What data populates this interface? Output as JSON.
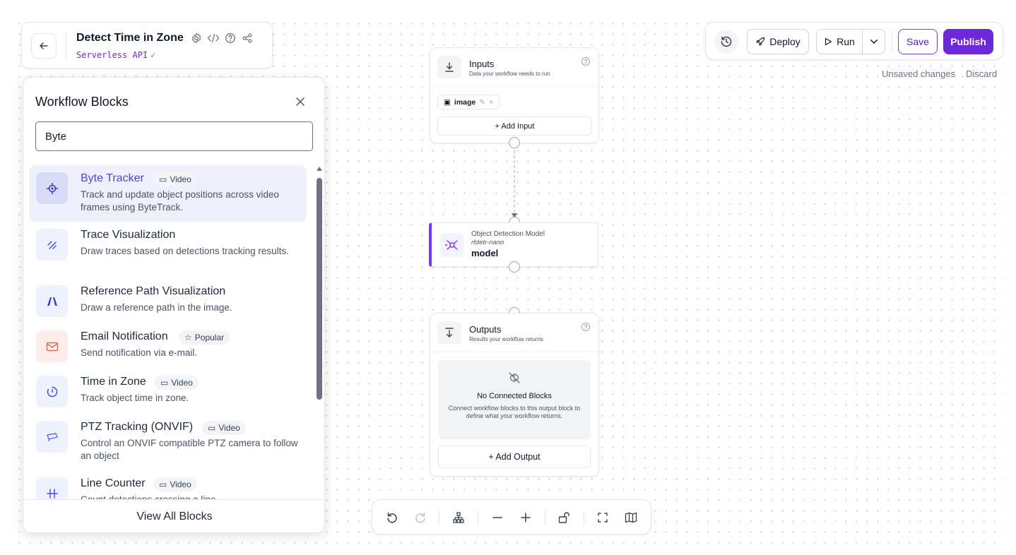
{
  "header": {
    "title": "Detect Time in Zone",
    "subtitle": "Serverless API",
    "icons": [
      "gear-icon",
      "code-icon",
      "help-icon",
      "share-icon"
    ]
  },
  "blocks_panel": {
    "title": "Workflow Blocks",
    "search_value": "Byte",
    "footer_label": "View All Blocks",
    "items": [
      {
        "name": "Byte Tracker",
        "tag": "Video",
        "desc": "Track and update object positions across video frames using ByteTrack.",
        "icon": "target-icon",
        "selected": true
      },
      {
        "name": "Trace Visualization",
        "tag": "",
        "desc": "Draw traces based on detections tracking results.",
        "icon": "trace-icon"
      },
      {
        "name": "Reference Path Visualization",
        "tag": "",
        "desc": "Draw a reference path in the image.",
        "icon": "path-icon"
      },
      {
        "name": "Email Notification",
        "tag": "Popular",
        "desc": "Send notification via e-mail.",
        "icon": "mail-icon"
      },
      {
        "name": "Time in Zone",
        "tag": "Video",
        "desc": "Track object time in zone.",
        "icon": "timer-icon"
      },
      {
        "name": "PTZ Tracking (ONVIF)",
        "tag": "Video",
        "desc": "Control an ONVIF compatible PTZ camera to follow an object",
        "icon": "camera-icon"
      },
      {
        "name": "Line Counter",
        "tag": "Video",
        "desc": "Count detections crossing a line.",
        "icon": "line-counter-icon"
      }
    ]
  },
  "inputs_node": {
    "title": "Inputs",
    "subtitle": "Data your workflow needs to run",
    "chip_label": "image",
    "add_label": "+ Add Input"
  },
  "model_node": {
    "type": "Object Detection Model",
    "variant": "rfdetr-nano",
    "name": "model"
  },
  "outputs_node": {
    "title": "Outputs",
    "subtitle": "Results your workflow returns",
    "empty_title": "No Connected Blocks",
    "empty_text": "Connect workflow blocks to this output block to define what your workflow returns.",
    "add_label": "+ Add Output"
  },
  "top_toolbar": {
    "deploy_label": "Deploy",
    "run_label": "Run",
    "save_label": "Save",
    "publish_label": "Publish",
    "unsaved_label": "Unsaved changes",
    "discard_label": "Discard"
  },
  "colors": {
    "accent": "#6d28d9",
    "selected_bg": "#eef0fb",
    "success": "#10b981"
  }
}
